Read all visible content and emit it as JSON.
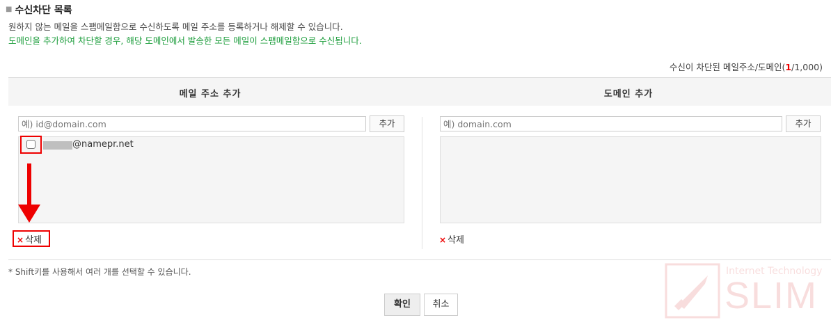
{
  "section": {
    "title": "수신차단 목록",
    "description": "원하지 않는 메일을 스팸메일함으로 수신하도록 메일 주소를 등록하거나 해제할 수 있습니다.",
    "notice": "도메인을 추가하여 차단할 경우, 해당 도메인에서 발송한 모든 메일이 스팸메일함으로 수신됩니다.",
    "notice_color": "#1a9c3a"
  },
  "counter": {
    "prefix": "수신이 차단된 메일주소/도메인(",
    "current": "1",
    "suffix": "/1,000)"
  },
  "email_panel": {
    "header": "메일 주소 추가",
    "input_placeholder": "예) id@domain.com",
    "add_label": "추가",
    "items": [
      {
        "email_domain": "@namepr.net",
        "checked": false
      }
    ],
    "delete_label": "삭제"
  },
  "domain_panel": {
    "header": "도메인 추가",
    "input_placeholder": "예) domain.com",
    "add_label": "추가",
    "items": [],
    "delete_label": "삭제"
  },
  "footnote": "* Shift키를 사용해서 여러 개를 선택할 수 있습니다.",
  "buttons": {
    "confirm": "확인",
    "cancel": "취소"
  },
  "watermark": {
    "line1": "Internet Technology",
    "line2": "SLIM"
  },
  "colors": {
    "accent_red": "#e00000",
    "header_bg": "#f5f5f5"
  }
}
